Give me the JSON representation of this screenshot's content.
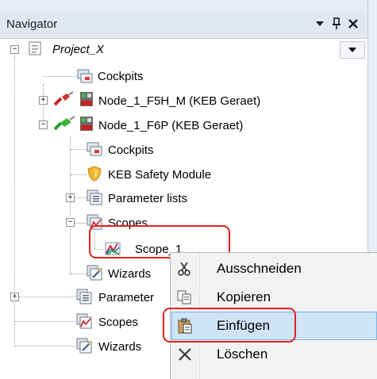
{
  "navigator": {
    "title": "Navigator",
    "controls": {
      "menu": "▼",
      "pin": "ᚂ",
      "close": "✕"
    }
  },
  "tree": {
    "project": "Project_X",
    "cockpits_1": "Cockpits",
    "node1": "Node_1_F5H_M (KEB Geraet)",
    "node2": "Node_1_F6P (KEB Geraet)",
    "cockpits_2": "Cockpits",
    "safety": "KEB Safety Module",
    "param_lists": "Parameter lists",
    "scopes": "Scopes",
    "scope1": "Scope_1",
    "wizards_1": "Wizards",
    "param_2": "Parameter",
    "scopes_2": "Scopes",
    "wizards_2": "Wizards"
  },
  "context_menu": {
    "items": [
      {
        "label": "Ausschneiden",
        "icon": "scissors-icon"
      },
      {
        "label": "Kopieren",
        "icon": "copy-icon"
      },
      {
        "label": "Einfügen",
        "icon": "paste-icon"
      },
      {
        "label": "Löschen",
        "icon": "delete-icon"
      }
    ],
    "selected_label": "Einfügen"
  },
  "colors": {
    "highlight": "#e2211c",
    "selection": "#cde5f7",
    "titlebar": "#e1e7f1"
  }
}
